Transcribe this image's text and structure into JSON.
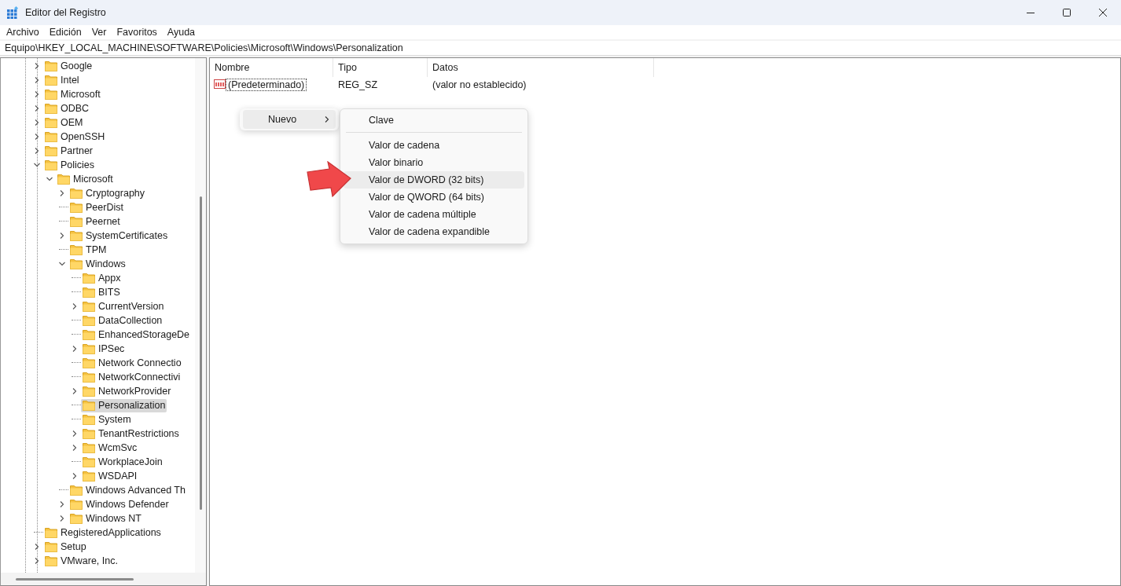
{
  "window": {
    "title": "Editor del Registro"
  },
  "menu": [
    "Archivo",
    "Edición",
    "Ver",
    "Favoritos",
    "Ayuda"
  ],
  "address": "Equipo\\HKEY_LOCAL_MACHINE\\SOFTWARE\\Policies\\Microsoft\\Windows\\Personalization",
  "tree": [
    {
      "label": "Google",
      "kind": "collapsed",
      "selected": false
    },
    {
      "label": "Intel",
      "kind": "collapsed",
      "selected": false
    },
    {
      "label": "Microsoft",
      "kind": "collapsed",
      "selected": false
    },
    {
      "label": "ODBC",
      "kind": "collapsed",
      "selected": false
    },
    {
      "label": "OEM",
      "kind": "collapsed",
      "selected": false
    },
    {
      "label": "OpenSSH",
      "kind": "collapsed",
      "selected": false
    },
    {
      "label": "Partner",
      "kind": "collapsed",
      "selected": false
    },
    {
      "label": "Policies",
      "kind": "expanded",
      "selected": false,
      "children": [
        {
          "label": "Microsoft",
          "kind": "expanded",
          "selected": false,
          "children": [
            {
              "label": "Cryptography",
              "kind": "collapsed",
              "selected": false
            },
            {
              "label": "PeerDist",
              "kind": "leaf",
              "selected": false
            },
            {
              "label": "Peernet",
              "kind": "leaf",
              "selected": false
            },
            {
              "label": "SystemCertificates",
              "kind": "collapsed",
              "selected": false
            },
            {
              "label": "TPM",
              "kind": "leaf",
              "selected": false
            },
            {
              "label": "Windows",
              "kind": "expanded",
              "selected": false,
              "children": [
                {
                  "label": "Appx",
                  "kind": "leaf",
                  "selected": false
                },
                {
                  "label": "BITS",
                  "kind": "leaf",
                  "selected": false
                },
                {
                  "label": "CurrentVersion",
                  "kind": "collapsed",
                  "selected": false
                },
                {
                  "label": "DataCollection",
                  "kind": "leaf",
                  "selected": false
                },
                {
                  "label": "EnhancedStorageDe",
                  "kind": "leaf",
                  "selected": false
                },
                {
                  "label": "IPSec",
                  "kind": "collapsed",
                  "selected": false
                },
                {
                  "label": "Network Connectio",
                  "kind": "leaf",
                  "selected": false
                },
                {
                  "label": "NetworkConnectivi",
                  "kind": "leaf",
                  "selected": false
                },
                {
                  "label": "NetworkProvider",
                  "kind": "collapsed",
                  "selected": false
                },
                {
                  "label": "Personalization",
                  "kind": "leaf",
                  "selected": true
                },
                {
                  "label": "System",
                  "kind": "leaf",
                  "selected": false
                },
                {
                  "label": "TenantRestrictions",
                  "kind": "collapsed",
                  "selected": false
                },
                {
                  "label": "WcmSvc",
                  "kind": "collapsed",
                  "selected": false
                },
                {
                  "label": "WorkplaceJoin",
                  "kind": "leaf",
                  "selected": false
                },
                {
                  "label": "WSDAPI",
                  "kind": "collapsed",
                  "selected": false
                }
              ]
            },
            {
              "label": "Windows Advanced Th",
              "kind": "leaf",
              "selected": false
            },
            {
              "label": "Windows Defender",
              "kind": "collapsed",
              "selected": false
            },
            {
              "label": "Windows NT",
              "kind": "collapsed",
              "selected": false
            }
          ]
        }
      ]
    },
    {
      "label": "RegisteredApplications",
      "kind": "leaf",
      "selected": false
    },
    {
      "label": "Setup",
      "kind": "collapsed",
      "selected": false
    },
    {
      "label": "VMware, Inc.",
      "kind": "collapsed",
      "selected": false
    }
  ],
  "table": {
    "columns": [
      "Nombre",
      "Tipo",
      "Datos"
    ],
    "rows": [
      {
        "name": "(Predeterminado)",
        "type": "REG_SZ",
        "data": "(valor no establecido)"
      }
    ]
  },
  "context_menu": {
    "label": "Nuevo"
  },
  "submenu": [
    {
      "label": "Clave",
      "selected": false
    },
    {
      "label": "Valor de cadena",
      "selected": false
    },
    {
      "label": "Valor binario",
      "selected": false
    },
    {
      "label": "Valor de DWORD (32 bits)",
      "selected": true
    },
    {
      "label": "Valor de QWORD (64 bits)",
      "selected": false
    },
    {
      "label": "Valor de cadena múltiple",
      "selected": false
    },
    {
      "label": "Valor de cadena expandible",
      "selected": false
    }
  ]
}
